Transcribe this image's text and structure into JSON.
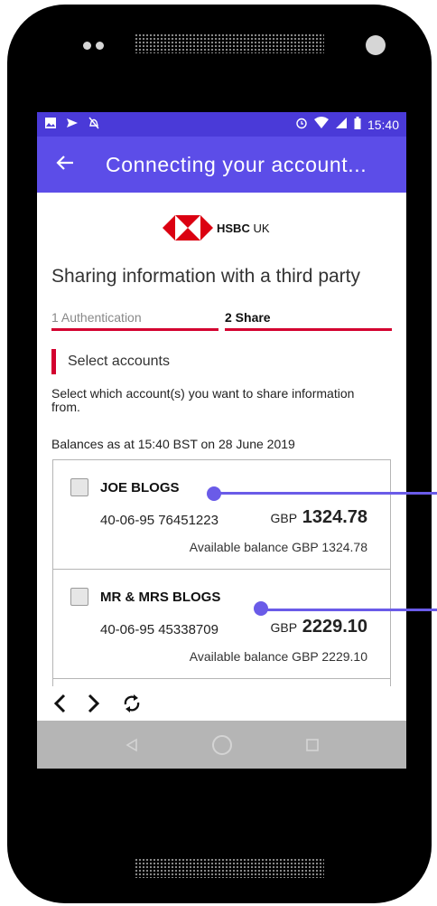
{
  "status_bar": {
    "time": "15:40"
  },
  "app_bar": {
    "title": "Connecting your account..."
  },
  "brand": {
    "bold": "HSBC",
    "suffix": " UK",
    "red": "#db0011"
  },
  "page": {
    "heading": "Sharing information with a third party",
    "steps": [
      {
        "label": "1 Authentication"
      },
      {
        "label": "2 Share"
      }
    ],
    "section_title": "Select accounts",
    "instruction": "Select which account(s) you want to share information from.",
    "balances_as_at": "Balances as at 15:40 BST on 28 June 2019"
  },
  "accounts": [
    {
      "name": "JOE BLOGS",
      "number": "40-06-95 76451223",
      "currency": "GBP",
      "balance": "1324.78",
      "available": "Available balance GBP 1324.78"
    },
    {
      "name": "MR & MRS BLOGS",
      "number": "40-06-95 45338709",
      "currency": "GBP",
      "balance": "2229.10",
      "available": "Available balance GBP 2229.10"
    }
  ],
  "browser_nav": {
    "icons": [
      "chevron-left-icon",
      "chevron-right-icon",
      "refresh-icon"
    ]
  },
  "system_nav": {
    "icons": [
      "back-triangle-icon",
      "home-circle-icon",
      "recents-square-icon"
    ]
  },
  "colors": {
    "accent": "#5c4de8",
    "status_bar": "#4a3ad8",
    "brand_red": "#d3002f",
    "annotation": "#6a5be8"
  }
}
